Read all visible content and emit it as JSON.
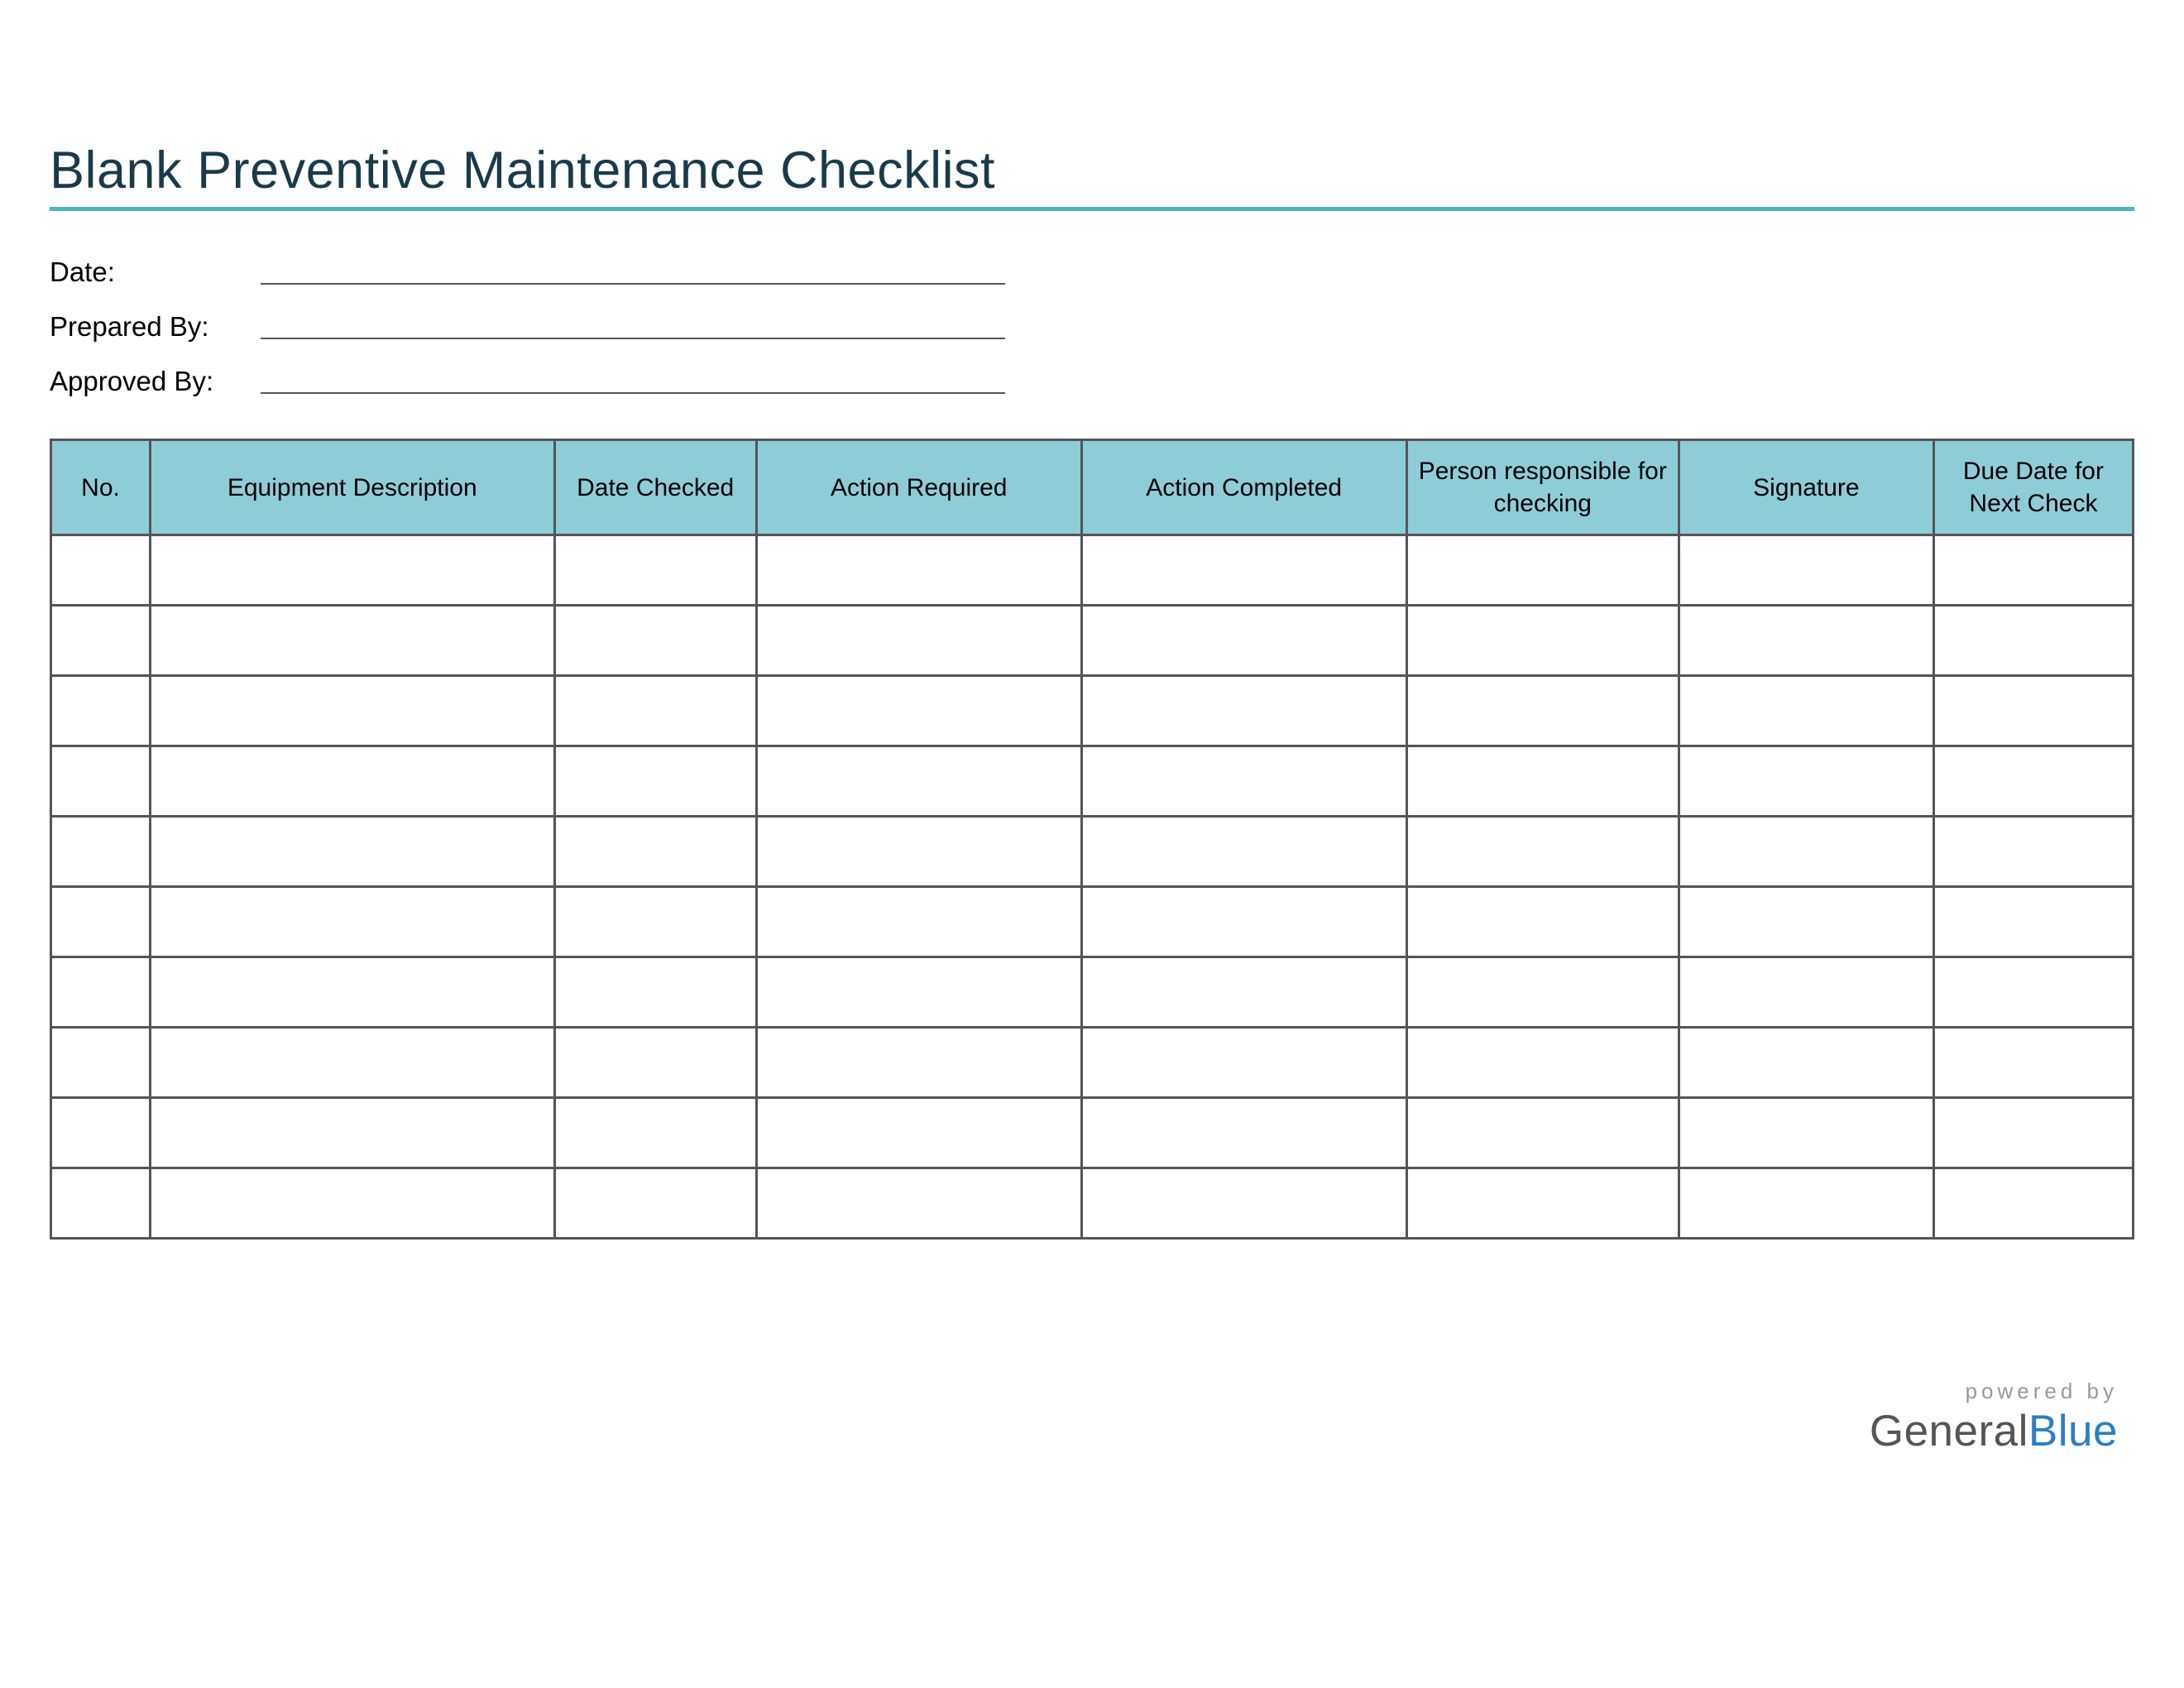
{
  "title": "Blank Preventive Maintenance Checklist",
  "meta": {
    "date_label": "Date:",
    "date_value": "",
    "prepared_label": "Prepared By:",
    "prepared_value": "",
    "approved_label": "Approved By:",
    "approved_value": ""
  },
  "table": {
    "headers": {
      "no": "No.",
      "equipment": "Equipment Description",
      "date_checked": "Date Checked",
      "action_required": "Action Required",
      "action_completed": "Action Completed",
      "person_responsible": "Person responsible for checking",
      "signature": "Signature",
      "due_date": "Due Date for Next Check"
    },
    "row_count": 10
  },
  "footer": {
    "powered_by": "powered by",
    "brand_general": "General",
    "brand_blue": "Blue"
  },
  "colors": {
    "accent": "#4fb3c4",
    "header_bg": "#8ecdd8",
    "border": "#555555",
    "title_color": "#1a3a4a",
    "brand_blue": "#2a7fc4"
  }
}
